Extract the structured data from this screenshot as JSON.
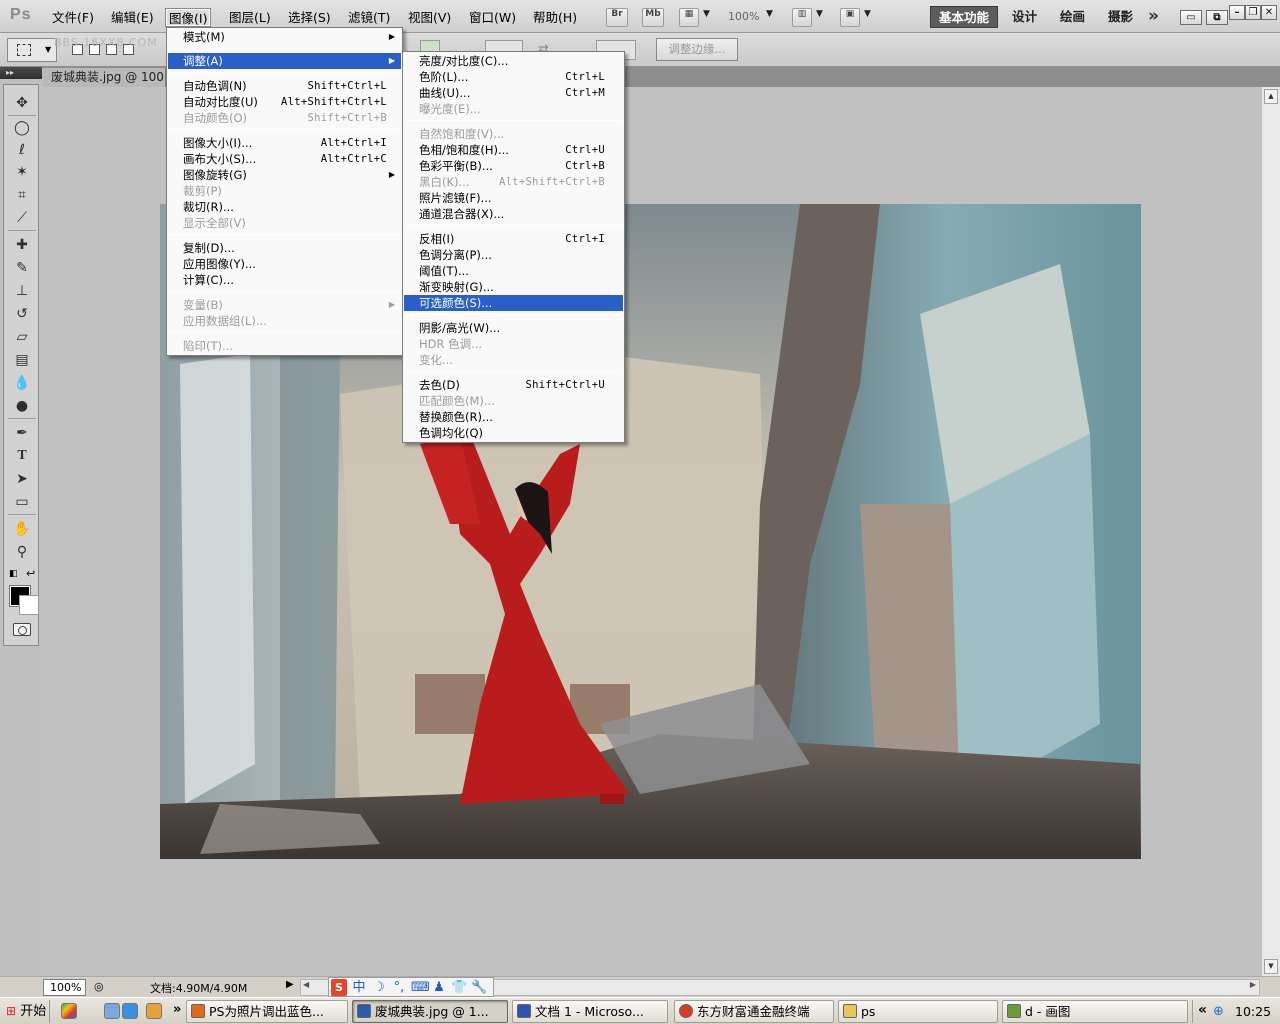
{
  "app": {
    "logo": "Ps",
    "watermark": "BBS.16XX8.COM"
  },
  "menubar": {
    "items": [
      "文件(F)",
      "编辑(E)",
      "图像(I)",
      "图层(L)",
      "选择(S)",
      "滤镜(T)",
      "视图(V)",
      "窗口(W)",
      "帮助(H)"
    ],
    "bridge": "Br",
    "minibridge": "Mb",
    "zoom": "100%",
    "workspaces": [
      "基本功能",
      "设计",
      "绘画",
      "摄影"
    ]
  },
  "options": {
    "refine_edge": "调整边缘..."
  },
  "document": {
    "tab_title": "废城典装.jpg @ 100"
  },
  "status": {
    "zoom": "100%",
    "doc_size": "文档:4.90M/4.90M"
  },
  "ime": {
    "sogou": "S",
    "lang": "中"
  },
  "image_menu": {
    "items": [
      {
        "label": "模式(M)",
        "shortcut": "",
        "submenu": true,
        "disabled": false
      },
      {
        "label": "调整(A)",
        "shortcut": "",
        "submenu": true,
        "disabled": false,
        "highlighted": true
      },
      {
        "label": "自动色调(N)",
        "shortcut": "Shift+Ctrl+L",
        "disabled": false
      },
      {
        "label": "自动对比度(U)",
        "shortcut": "Alt+Shift+Ctrl+L",
        "disabled": false
      },
      {
        "label": "自动颜色(O)",
        "shortcut": "Shift+Ctrl+B",
        "disabled": true
      },
      {
        "label": "图像大小(I)...",
        "shortcut": "Alt+Ctrl+I",
        "disabled": false
      },
      {
        "label": "画布大小(S)...",
        "shortcut": "Alt+Ctrl+C",
        "disabled": false
      },
      {
        "label": "图像旋转(G)",
        "shortcut": "",
        "submenu": true,
        "disabled": false
      },
      {
        "label": "裁剪(P)",
        "shortcut": "",
        "disabled": true
      },
      {
        "label": "裁切(R)...",
        "shortcut": "",
        "disabled": false
      },
      {
        "label": "显示全部(V)",
        "shortcut": "",
        "disabled": true
      },
      {
        "label": "复制(D)...",
        "shortcut": "",
        "disabled": false
      },
      {
        "label": "应用图像(Y)...",
        "shortcut": "",
        "disabled": false
      },
      {
        "label": "计算(C)...",
        "shortcut": "",
        "disabled": false
      },
      {
        "label": "变量(B)",
        "shortcut": "",
        "submenu": true,
        "disabled": true
      },
      {
        "label": "应用数据组(L)...",
        "shortcut": "",
        "disabled": true
      },
      {
        "label": "陷印(T)...",
        "shortcut": "",
        "disabled": true
      }
    ]
  },
  "adjust_menu": {
    "items": [
      {
        "label": "亮度/对比度(C)...",
        "shortcut": "",
        "disabled": false
      },
      {
        "label": "色阶(L)...",
        "shortcut": "Ctrl+L",
        "disabled": false
      },
      {
        "label": "曲线(U)...",
        "shortcut": "Ctrl+M",
        "disabled": false
      },
      {
        "label": "曝光度(E)...",
        "shortcut": "",
        "disabled": true
      },
      {
        "label": "自然饱和度(V)...",
        "shortcut": "",
        "disabled": true
      },
      {
        "label": "色相/饱和度(H)...",
        "shortcut": "Ctrl+U",
        "disabled": false
      },
      {
        "label": "色彩平衡(B)...",
        "shortcut": "Ctrl+B",
        "disabled": false
      },
      {
        "label": "黑白(K)...",
        "shortcut": "Alt+Shift+Ctrl+B",
        "disabled": true
      },
      {
        "label": "照片滤镜(F)...",
        "shortcut": "",
        "disabled": false
      },
      {
        "label": "通道混合器(X)...",
        "shortcut": "",
        "disabled": false
      },
      {
        "label": "反相(I)",
        "shortcut": "Ctrl+I",
        "disabled": false
      },
      {
        "label": "色调分离(P)...",
        "shortcut": "",
        "disabled": false
      },
      {
        "label": "阈值(T)...",
        "shortcut": "",
        "disabled": false
      },
      {
        "label": "渐变映射(G)...",
        "shortcut": "",
        "disabled": false
      },
      {
        "label": "可选颜色(S)...",
        "shortcut": "",
        "disabled": false,
        "highlighted": true
      },
      {
        "label": "阴影/高光(W)...",
        "shortcut": "",
        "disabled": false
      },
      {
        "label": "HDR 色调...",
        "shortcut": "",
        "disabled": true
      },
      {
        "label": "变化...",
        "shortcut": "",
        "disabled": true
      },
      {
        "label": "去色(D)",
        "shortcut": "Shift+Ctrl+U",
        "disabled": false
      },
      {
        "label": "匹配颜色(M)...",
        "shortcut": "",
        "disabled": true
      },
      {
        "label": "替换颜色(R)...",
        "shortcut": "",
        "disabled": false
      },
      {
        "label": "色调均化(Q)",
        "shortcut": "",
        "disabled": false
      }
    ]
  },
  "taskbar": {
    "start": "开始",
    "more": "»",
    "tasks": [
      {
        "label": "PS为照片调出蓝色...",
        "icon_color": "#e06a1c"
      },
      {
        "label": "废城典装.jpg @ 1...",
        "icon_color": "#2b5aa8",
        "active": true
      },
      {
        "label": "文档 1 - Microso...",
        "icon_color": "#2b55b3"
      },
      {
        "label": "东方财富通金融终端",
        "icon_color": "#d93a2a"
      },
      {
        "label": "ps",
        "icon_color": "#e8c65a"
      },
      {
        "label": "d - 画图",
        "icon_color": "#6a9a3a"
      }
    ],
    "clock": "10:25",
    "tray_expand": "«"
  },
  "colors": {
    "menu_highlight": "#2a5fc8",
    "dress_red": "#b81c1c",
    "wall_teal": "#6f9aa2"
  }
}
